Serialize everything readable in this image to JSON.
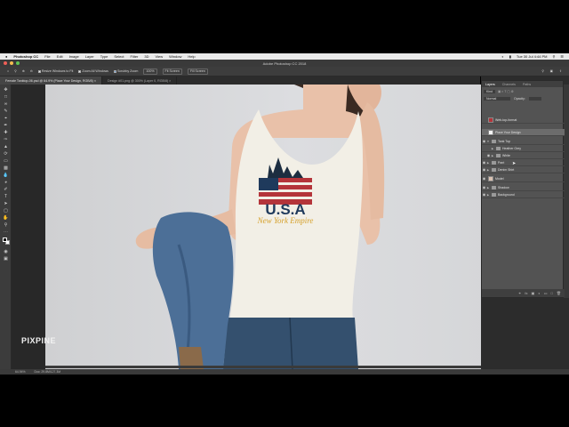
{
  "menubar": {
    "apple": "",
    "app": "Photoshop CC",
    "items": [
      "File",
      "Edit",
      "Image",
      "Layer",
      "Type",
      "Select",
      "Filter",
      "3D",
      "View",
      "Window",
      "Help"
    ],
    "clock": "Tue 30 Jul 4:44 PM"
  },
  "titlebar": {
    "title": "Adobe Photoshop CC 2018"
  },
  "options": {
    "resize": "Resize Windows to Fit",
    "zoom_all": "Zoom All Windows",
    "scrubby": "Scrubby Zoom",
    "pct": "100%",
    "fit": "Fit Screen",
    "fill": "Fill Screen"
  },
  "tabs": [
    {
      "label": "Female Tanktop-06.psd @ 64.9% (Place Your Design, RGB/8) ×"
    },
    {
      "label": "Design #01.png @ 300% (Layer 0, RGB/8) ×"
    }
  ],
  "canvas": {
    "watermark": "PIXPINE"
  },
  "status": {
    "zoom": "64.94%",
    "doc": "Doc: 29.8M/127.3M"
  },
  "layers_panel": {
    "tabs": [
      "Layers",
      "Channels",
      "Paths"
    ],
    "filter": "Kind",
    "mode": "Normal",
    "opacity": "Opacity:",
    "rows": [
      {
        "name": "Web-top-format",
        "type": "layer",
        "visible": false,
        "selected": false
      },
      {
        "name": "Place Your Design",
        "type": "layer",
        "visible": false,
        "selected": true
      },
      {
        "name": "Tank Top",
        "type": "group",
        "visible": true,
        "selected": false
      },
      {
        "name": "Heather Grey",
        "type": "group",
        "visible": false,
        "selected": false
      },
      {
        "name": "White",
        "type": "group",
        "visible": true,
        "selected": false
      },
      {
        "name": "Pant",
        "type": "group",
        "visible": true,
        "selected": false
      },
      {
        "name": "Denim Shirt",
        "type": "group",
        "visible": true,
        "selected": false
      },
      {
        "name": "Model",
        "type": "layer",
        "visible": true,
        "selected": false
      },
      {
        "name": "Shadow",
        "type": "group",
        "visible": true,
        "selected": false
      },
      {
        "name": "Background",
        "type": "group",
        "visible": true,
        "selected": false
      }
    ]
  },
  "design": {
    "line1": "U.S.A",
    "line2": "New York Empire"
  },
  "colors": {
    "accent": "#d6a12c",
    "flag_red": "#b4343a",
    "navy": "#1f3a5c"
  }
}
